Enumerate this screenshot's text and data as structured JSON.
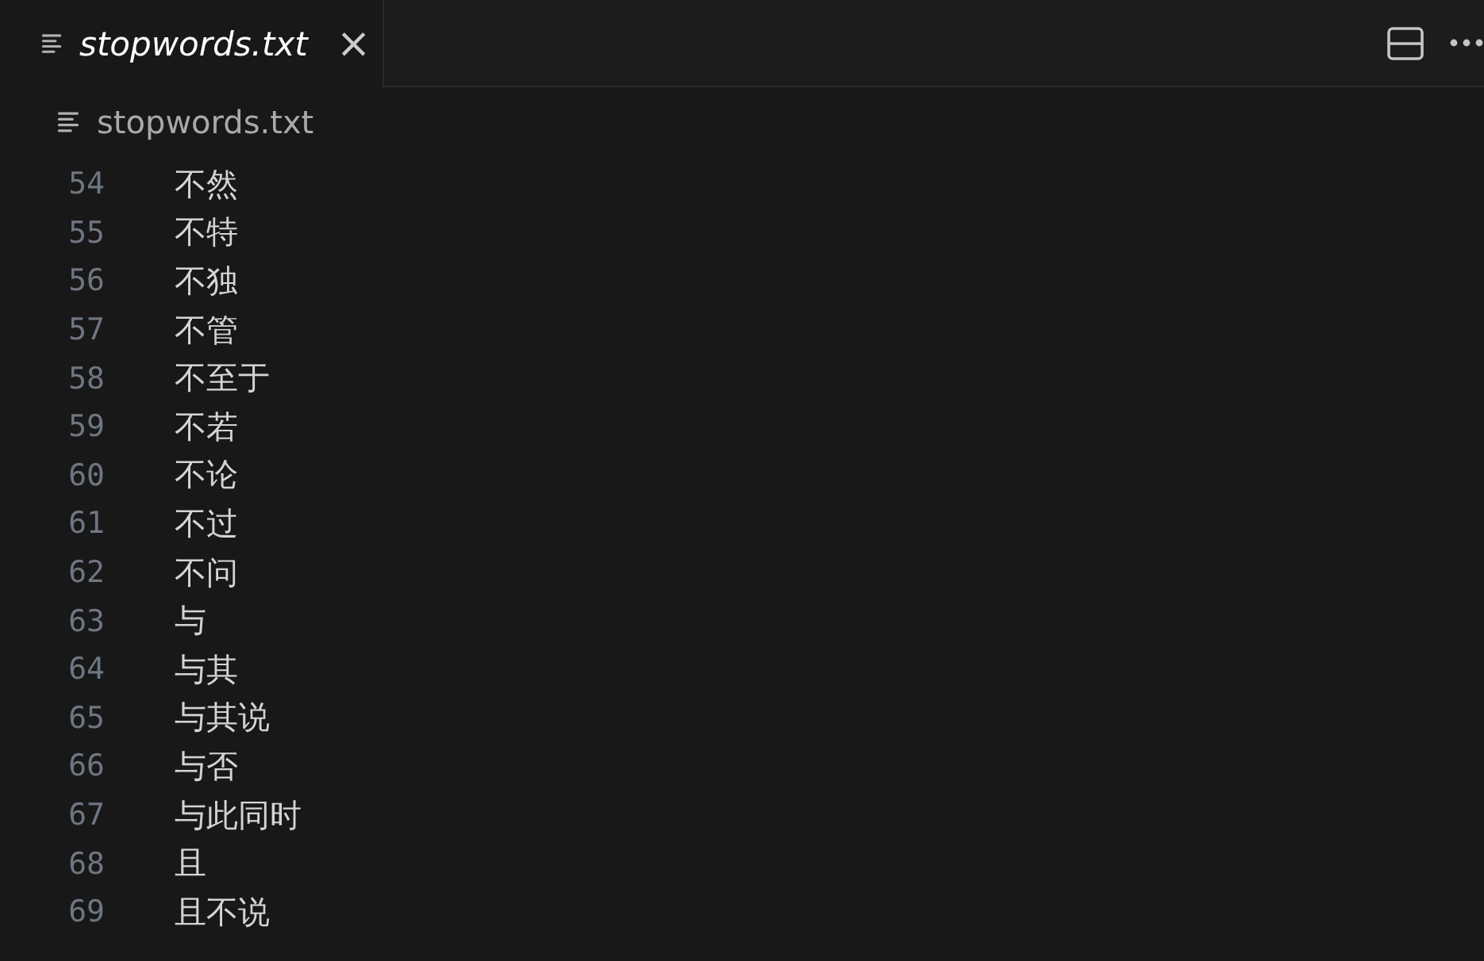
{
  "tabs": [
    {
      "label": "stopwords.txt",
      "selected": true,
      "close": "×"
    }
  ],
  "breadcrumb": {
    "label": "stopwords.txt"
  },
  "lines": [
    {
      "number": "54",
      "text": "不然"
    },
    {
      "number": "55",
      "text": "不特"
    },
    {
      "number": "56",
      "text": "不独"
    },
    {
      "number": "57",
      "text": "不管"
    },
    {
      "number": "58",
      "text": "不至于"
    },
    {
      "number": "59",
      "text": "不若"
    },
    {
      "number": "60",
      "text": "不论"
    },
    {
      "number": "61",
      "text": "不过"
    },
    {
      "number": "62",
      "text": "不问"
    },
    {
      "number": "63",
      "text": "与"
    },
    {
      "number": "64",
      "text": "与其"
    },
    {
      "number": "65",
      "text": "与其说"
    },
    {
      "number": "66",
      "text": "与否"
    },
    {
      "number": "67",
      "text": "与此同时"
    },
    {
      "number": "68",
      "text": "且"
    },
    {
      "number": "69",
      "text": "且不说"
    }
  ]
}
